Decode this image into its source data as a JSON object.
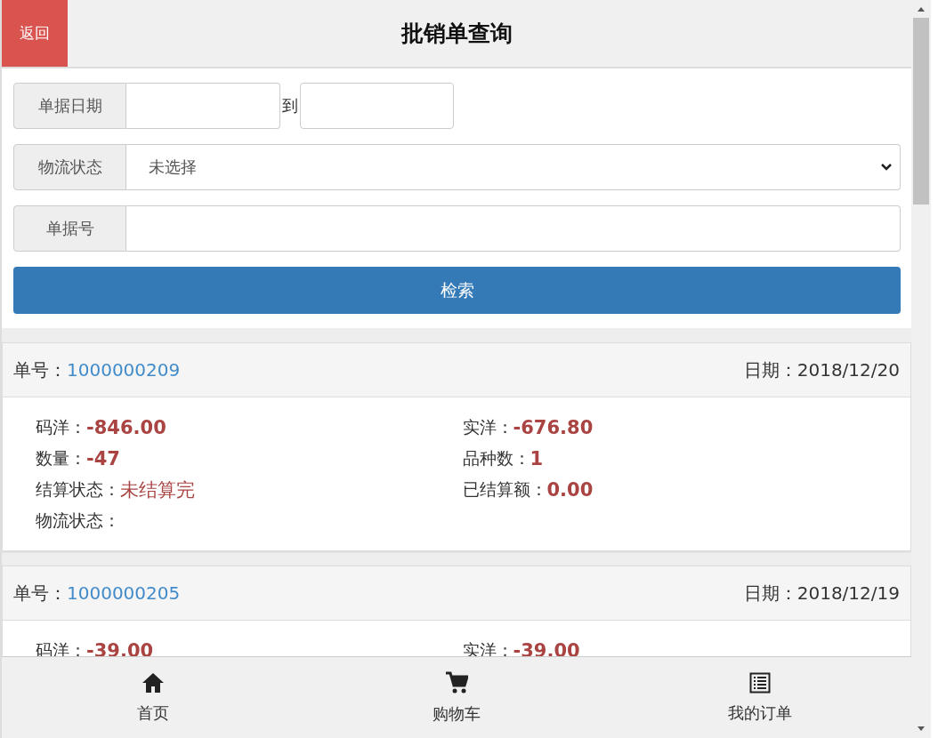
{
  "header": {
    "back_button": "返回",
    "title": "批销单查询"
  },
  "filters": {
    "date_label": "单据日期",
    "date_separator": "到",
    "status_label": "物流状态",
    "status_value": "未选择",
    "number_label": "单据号",
    "search_button": "检索"
  },
  "orders": [
    {
      "number_label": "单号：",
      "number": "1000000209",
      "date_label": "日期：",
      "date": "2018/12/20",
      "fields": [
        {
          "label": "码洋：",
          "value": "-846.00",
          "kind": "amount"
        },
        {
          "label": "实洋：",
          "value": "-676.80",
          "kind": "amount"
        },
        {
          "label": "数量：",
          "value": "-47",
          "kind": "amount"
        },
        {
          "label": "品种数：",
          "value": "1",
          "kind": "amount"
        },
        {
          "label": "结算状态：",
          "value": "未结算完",
          "kind": "status"
        },
        {
          "label": "已结算额：",
          "value": "0.00",
          "kind": "amount"
        },
        {
          "label": "物流状态：",
          "kind": "empty"
        }
      ]
    },
    {
      "number_label": "单号：",
      "number": "1000000205",
      "date_label": "日期：",
      "date": "2018/12/19",
      "fields": [
        {
          "label": "码洋：",
          "value": "-39.00",
          "kind": "amount"
        },
        {
          "label": "实洋：",
          "value": "-39.00",
          "kind": "amount"
        }
      ]
    }
  ],
  "nav": [
    {
      "label": "首页",
      "kind": "home"
    },
    {
      "label": "购物车",
      "kind": "cart"
    },
    {
      "label": "我的订单",
      "kind": "orders"
    }
  ]
}
